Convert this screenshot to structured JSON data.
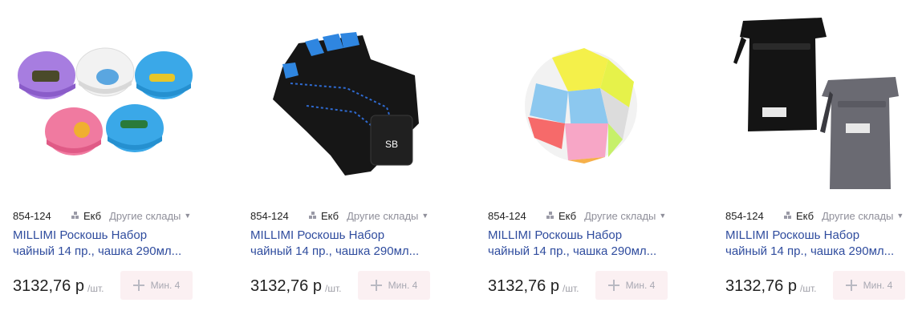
{
  "products": [
    {
      "image_icon": "swim-caps-image",
      "sku": "854-124",
      "city": "Екб",
      "other_stores": "Другие склады",
      "title_line1": "MILLIMI Роскошь Набор",
      "title_line2": "чайный 14 пр., чашка 290мл...",
      "price": "3132,76 р",
      "unit": "/шт.",
      "min_label": "Мин. 4"
    },
    {
      "image_icon": "gloves-image",
      "sku": "854-124",
      "city": "Екб",
      "other_stores": "Другие склады",
      "title_line1": "MILLIMI Роскошь Набор",
      "title_line2": "чайный 14 пр., чашка 290мл...",
      "price": "3132,76 р",
      "unit": "/шт.",
      "min_label": "Мин. 4"
    },
    {
      "image_icon": "mesh-ball-image",
      "sku": "854-124",
      "city": "Екб",
      "other_stores": "Другие склады",
      "title_line1": "MILLIMI Роскошь Набор",
      "title_line2": "чайный 14 пр., чашка 290мл...",
      "price": "3132,76 р",
      "unit": "/шт.",
      "min_label": "Мин. 4"
    },
    {
      "image_icon": "backpacks-image",
      "sku": "854-124",
      "city": "Екб",
      "other_stores": "Другие склады",
      "title_line1": "MILLIMI Роскошь Набор",
      "title_line2": "чайный 14 пр., чашка 290мл...",
      "price": "3132,76 р",
      "unit": "/шт.",
      "min_label": "Мин. 4"
    }
  ],
  "colors": {
    "title_link": "#2f4c9e",
    "min_button_bg": "#fbf0f2",
    "muted": "#8f8f9a"
  }
}
